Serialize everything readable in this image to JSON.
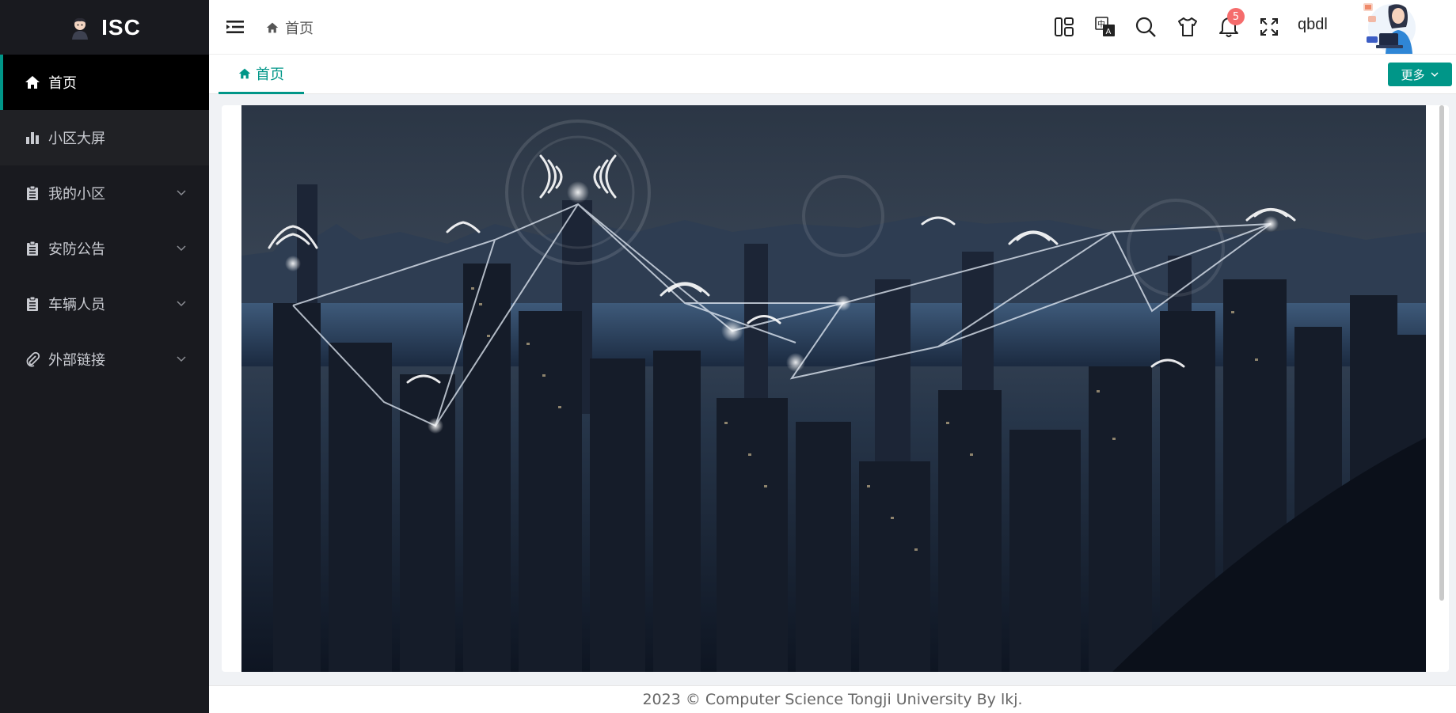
{
  "app": {
    "logo_text": "ISC"
  },
  "sidebar": {
    "items": [
      {
        "label": "首页",
        "icon": "home-icon",
        "expandable": false
      },
      {
        "label": "小区大屏",
        "icon": "bar-chart-icon",
        "expandable": false
      },
      {
        "label": "我的小区",
        "icon": "clipboard-icon",
        "expandable": true
      },
      {
        "label": "安防公告",
        "icon": "clipboard-icon",
        "expandable": true
      },
      {
        "label": "车辆人员",
        "icon": "clipboard-icon",
        "expandable": true
      },
      {
        "label": "外部链接",
        "icon": "paperclip-icon",
        "expandable": true
      }
    ]
  },
  "header": {
    "breadcrumb": "首页",
    "notification_count": "5",
    "username": "qbdl"
  },
  "tabs": {
    "items": [
      {
        "label": "首页"
      }
    ],
    "more_label": "更多"
  },
  "footer": {
    "text": "2023 © Computer Science Tongji University By lkj."
  },
  "colors": {
    "accent": "#009688",
    "sidebar_bg": "#191a1f",
    "badge": "#f56c6c"
  }
}
